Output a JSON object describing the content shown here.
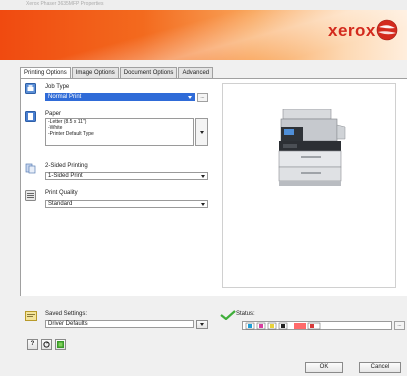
{
  "window": {
    "title": "Xerox Phaser 3635MFP Properties"
  },
  "header": {
    "brand": "xerox"
  },
  "tabs": [
    {
      "label": "Printing Options",
      "active": true
    },
    {
      "label": "Image Options",
      "active": false
    },
    {
      "label": "Document Options",
      "active": false
    },
    {
      "label": "Advanced",
      "active": false
    }
  ],
  "job_type": {
    "label": "Job Type",
    "value": "Normal Print",
    "more_label": "..."
  },
  "paper": {
    "label": "Paper",
    "lines": [
      "-Letter (8.5 x 11\")",
      "-White",
      "-Printer Default Type"
    ]
  },
  "two_sided": {
    "label": "2-Sided Printing",
    "value": "1-Sided Print"
  },
  "print_quality": {
    "label": "Print Quality",
    "value": "Standard"
  },
  "saved_settings": {
    "label": "Saved Settings:",
    "value": "Driver Defaults"
  },
  "status": {
    "label": "Status:",
    "more_label": "..."
  },
  "footer": {
    "help_label": "?",
    "ok_label": "OK",
    "cancel_label": "Cancel"
  },
  "colors": {
    "accent": "#f36a1e",
    "brand_red": "#d32a1d",
    "selection": "#2f6bd8"
  }
}
